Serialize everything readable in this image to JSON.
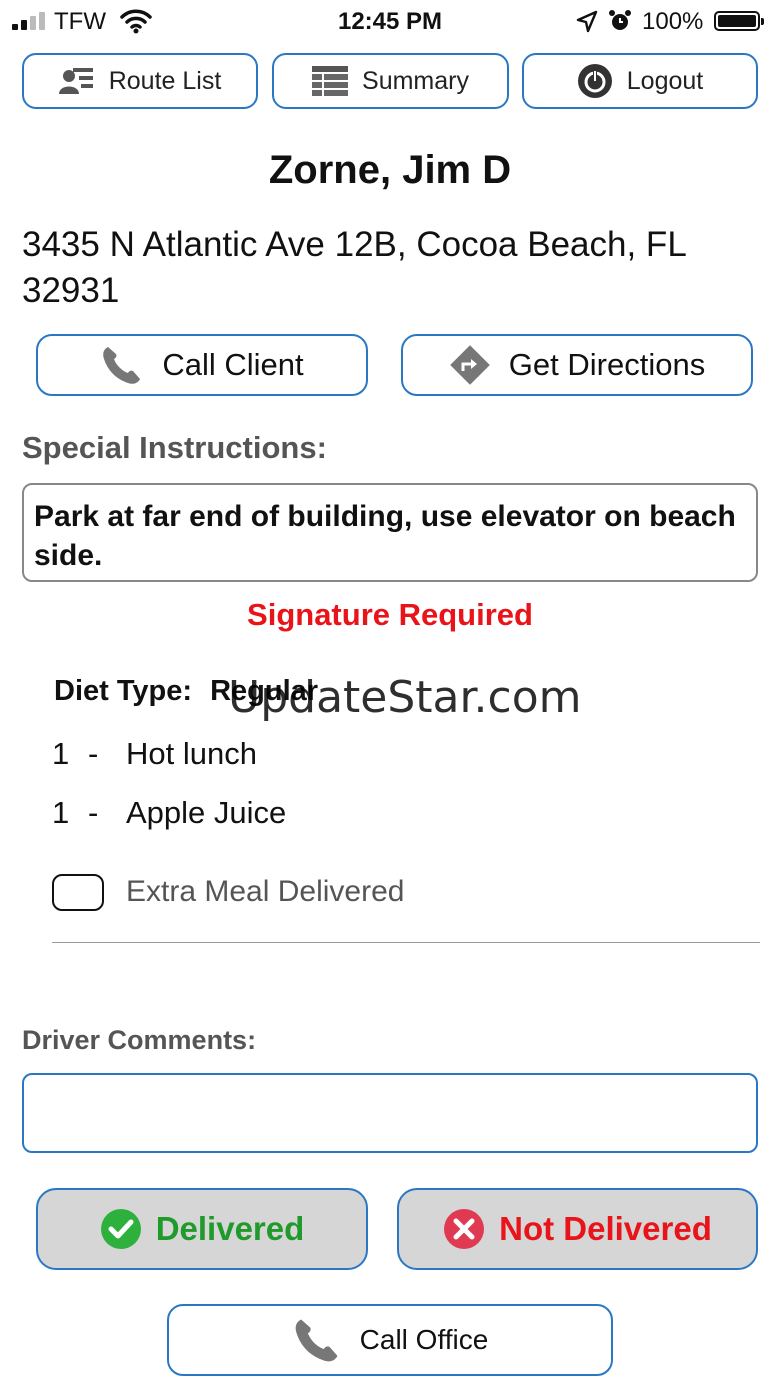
{
  "status_bar": {
    "carrier": "TFW",
    "time": "12:45 PM",
    "battery": "100%"
  },
  "top_nav": {
    "route_list": "Route List",
    "summary": "Summary",
    "logout": "Logout"
  },
  "client": {
    "name": "Zorne, Jim D",
    "address": "3435 N Atlantic Ave 12B, Cocoa Beach, FL 32931"
  },
  "actions": {
    "call_client": "Call Client",
    "get_directions": "Get Directions"
  },
  "instructions": {
    "label": "Special Instructions:",
    "text": "Park at far end of building, use elevator on beach side."
  },
  "signature_notice": "Signature Required",
  "diet": {
    "label": "Diet Type:",
    "value": "Regular"
  },
  "items": [
    {
      "qty": "1",
      "sep": "-",
      "name": "Hot lunch"
    },
    {
      "qty": "1",
      "sep": "-",
      "name": "Apple Juice"
    }
  ],
  "extra_meal": {
    "label": "Extra Meal Delivered",
    "checked": false
  },
  "driver_comments": {
    "label": "Driver Comments:",
    "value": ""
  },
  "delivery_buttons": {
    "delivered": "Delivered",
    "not_delivered": "Not Delivered"
  },
  "call_office": "Call Office",
  "watermark": "UpdateStar.com",
  "colors": {
    "accent_border": "#2a78c5",
    "alert_red": "#e8141a",
    "delivered_green": "#1f9a2b",
    "not_delivered_red": "#e8141a",
    "status_button_bg": "#d6d6d6"
  }
}
